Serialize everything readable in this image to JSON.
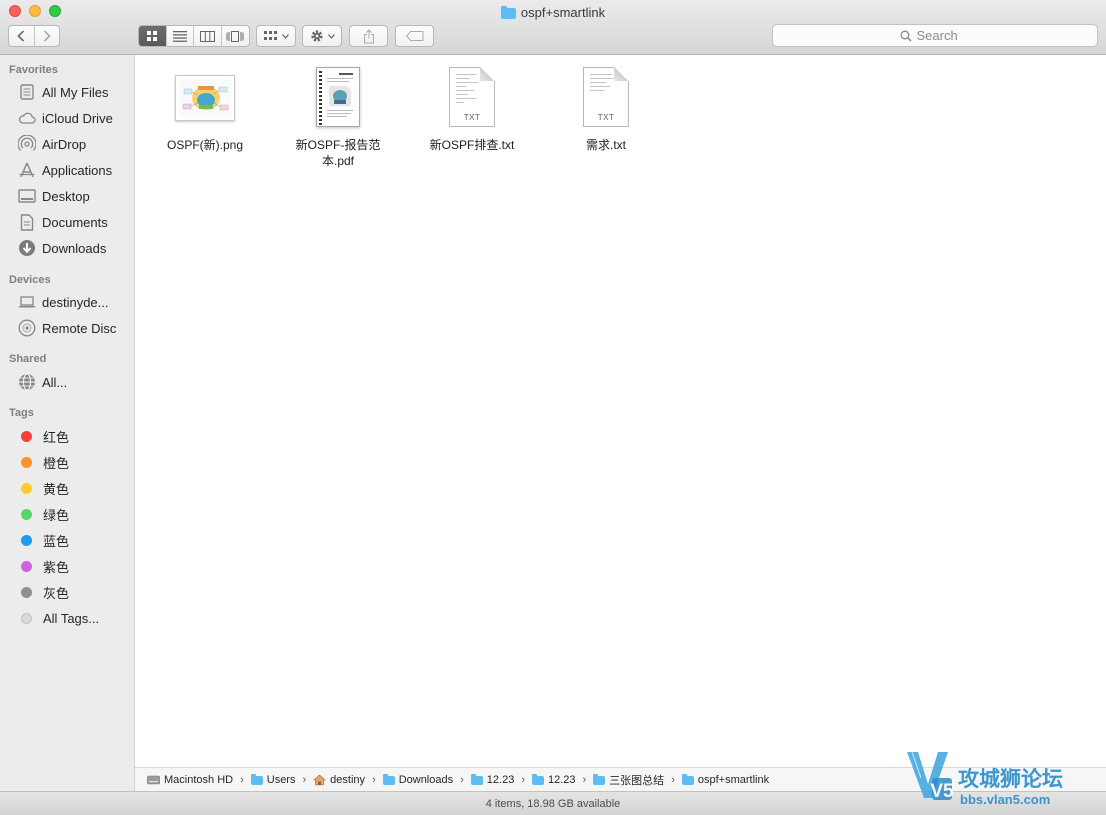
{
  "window": {
    "title": "ospf+smartlink"
  },
  "toolbar": {
    "back_icon": "chevron-left-icon",
    "forward_icon": "chevron-right-icon",
    "view_modes": [
      "icon-view",
      "list-view",
      "column-view",
      "cover-flow-view"
    ],
    "active_view": "icon-view",
    "arrange_icon": "grid-arrange-icon",
    "action_icon": "gear-icon",
    "share_icon": "share-icon",
    "tag_icon": "tag-icon"
  },
  "search": {
    "placeholder": "Search"
  },
  "sidebar": {
    "favorites_header": "Favorites",
    "favorites": [
      {
        "label": "All My Files",
        "icon": "all-files-icon"
      },
      {
        "label": "iCloud Drive",
        "icon": "cloud-icon"
      },
      {
        "label": "AirDrop",
        "icon": "airdrop-icon"
      },
      {
        "label": "Applications",
        "icon": "applications-icon"
      },
      {
        "label": "Desktop",
        "icon": "desktop-icon"
      },
      {
        "label": "Documents",
        "icon": "documents-icon"
      },
      {
        "label": "Downloads",
        "icon": "downloads-icon"
      }
    ],
    "devices_header": "Devices",
    "devices": [
      {
        "label": "destinyde...",
        "icon": "laptop-icon"
      },
      {
        "label": "Remote Disc",
        "icon": "disc-icon"
      }
    ],
    "shared_header": "Shared",
    "shared": [
      {
        "label": "All...",
        "icon": "network-globe-icon"
      }
    ],
    "tags_header": "Tags",
    "tags": [
      {
        "label": "红色",
        "color": "#fc3d39"
      },
      {
        "label": "橙色",
        "color": "#fd9426"
      },
      {
        "label": "黄色",
        "color": "#fecb2f"
      },
      {
        "label": "绿色",
        "color": "#53d769"
      },
      {
        "label": "蓝色",
        "color": "#1d9bf6"
      },
      {
        "label": "紫色",
        "color": "#ce62df"
      },
      {
        "label": "灰色",
        "color": "#8e8e93"
      },
      {
        "label": "All Tags...",
        "color": "#d8d8d8"
      }
    ]
  },
  "files": [
    {
      "name": "OSPF(新).png",
      "kind": "png"
    },
    {
      "name": "新OSPF-报告范本.pdf",
      "kind": "pdf"
    },
    {
      "name": "新OSPF排查.txt",
      "kind": "txt",
      "ext_label": "TXT"
    },
    {
      "name": "需求.txt",
      "kind": "txt",
      "ext_label": "TXT"
    }
  ],
  "pathbar": [
    {
      "label": "Macintosh HD",
      "icon": "hard-drive-icon"
    },
    {
      "label": "Users",
      "icon": "folder-icon"
    },
    {
      "label": "destiny",
      "icon": "home-icon"
    },
    {
      "label": "Downloads",
      "icon": "folder-icon"
    },
    {
      "label": "12.23",
      "icon": "folder-icon"
    },
    {
      "label": "12.23",
      "icon": "folder-icon"
    },
    {
      "label": "三张图总结",
      "icon": "folder-icon"
    },
    {
      "label": "ospf+smartlink",
      "icon": "folder-icon"
    }
  ],
  "status": {
    "text": "4 items, 18.98 GB available"
  },
  "watermark": {
    "logo_text": "V5",
    "brand": "攻城狮论坛",
    "url": "bbs.vlan5.com"
  }
}
